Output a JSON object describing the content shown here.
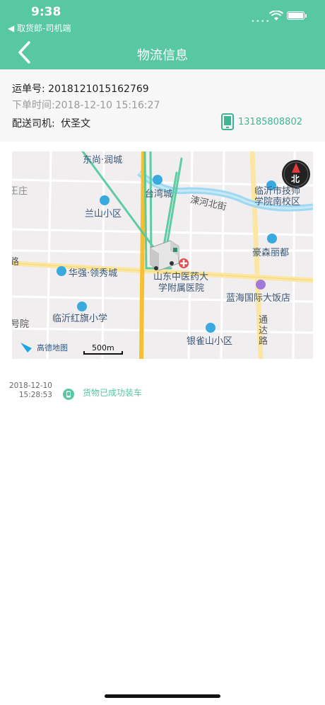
{
  "status_bar": {
    "time": "9:38",
    "back_app": "◀ 取货郎-司机端"
  },
  "nav": {
    "title": "物流信息"
  },
  "order": {
    "waybill_label": "运单号:",
    "waybill_no": "2018121015162769",
    "order_time_label": "下单时间:",
    "order_time": "2018-12-10 15:16:27",
    "driver_label": "配送司机:",
    "driver_name": "伏圣文",
    "phone": "13185808802"
  },
  "map": {
    "labels": {
      "runcheng": "东尚·润城",
      "wangzhuang": "王庄",
      "taiwancheng": "台湾城",
      "lanshan": "兰山小区",
      "sushu_road": "涑河北街",
      "jishi_school": "临沂市技师",
      "jishi_school2": "学院南校区",
      "haosen": "豪森丽都",
      "road_left": "路",
      "huaqiang": "华强·领秀城",
      "hospital1": "山东中医药大",
      "hospital2": "学附属医院",
      "lanhai": "蓝海国际大饭店",
      "hongqi": "临沂红旗小学",
      "haoyuan": "号院",
      "yinque": "银雀山小区",
      "tongda1": "通",
      "tongda2": "达",
      "tongda3": "路",
      "amap": "高德地图",
      "scale": "500m",
      "compass": "北"
    }
  },
  "timeline": [
    {
      "date": "2018-12-10",
      "time": "15:28:53",
      "text": "货物已成功装车"
    }
  ]
}
